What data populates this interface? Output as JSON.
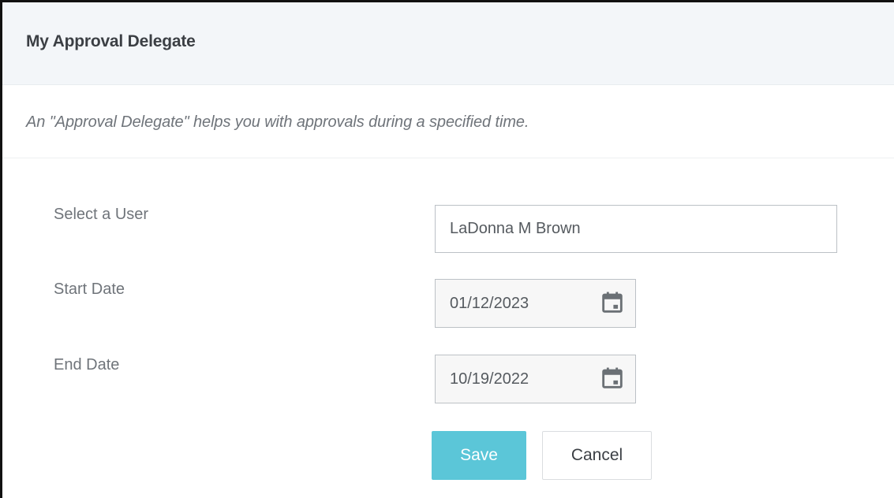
{
  "header": {
    "title": "My Approval Delegate"
  },
  "description": "An \"Approval Delegate\" helps you with approvals during a specified time.",
  "form": {
    "user": {
      "label": "Select a User",
      "value": "LaDonna M Brown"
    },
    "start_date": {
      "label": "Start Date",
      "value": "01/12/2023",
      "icon": "calendar-icon"
    },
    "end_date": {
      "label": "End Date",
      "value": "10/19/2022",
      "icon": "calendar-icon"
    }
  },
  "actions": {
    "save_label": "Save",
    "cancel_label": "Cancel"
  },
  "colors": {
    "accent": "#5bc6d8",
    "header_bg": "#f3f6f9"
  }
}
